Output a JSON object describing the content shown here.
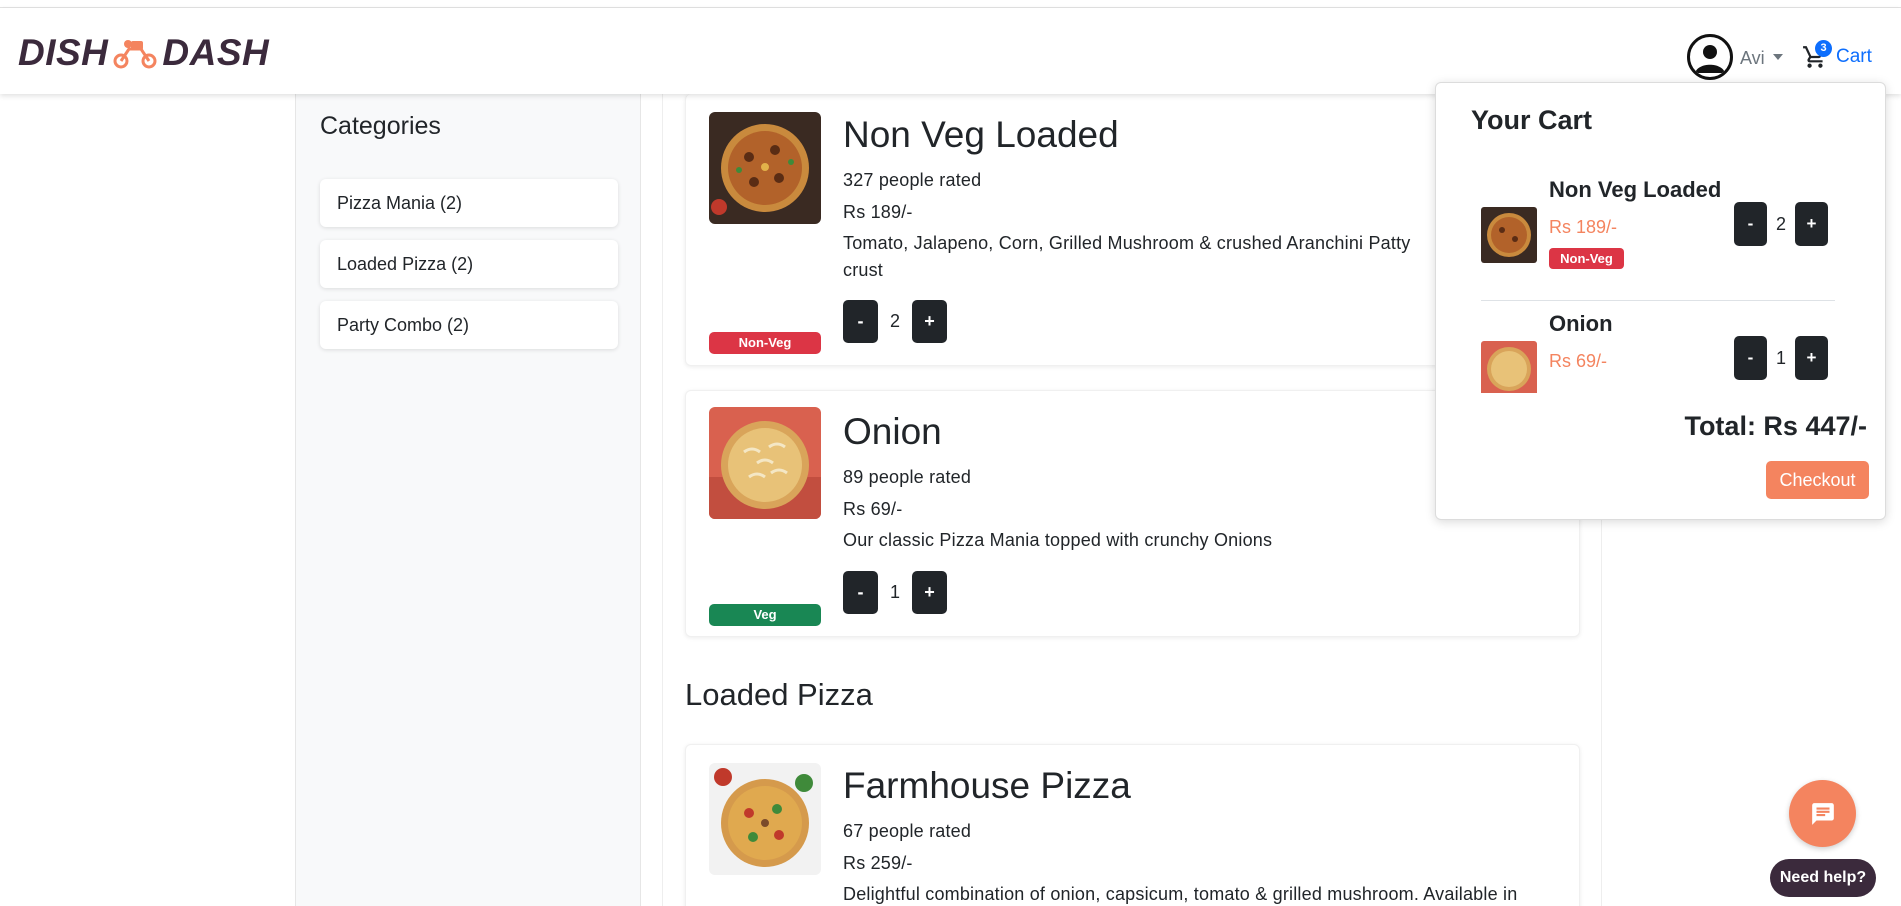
{
  "brand": {
    "logo_left": "DISH",
    "logo_right": "DASH"
  },
  "navbar": {
    "user_name": "Avi",
    "cart_label": "Cart",
    "cart_count": "3"
  },
  "sidebar": {
    "title": "Categories",
    "items": [
      {
        "label": "Pizza Mania (2)"
      },
      {
        "label": "Loaded Pizza (2)"
      },
      {
        "label": "Party Combo (2)"
      }
    ]
  },
  "menu": {
    "items": [
      {
        "name": "Non Veg Loaded",
        "ratings": "327 people rated",
        "price": "Rs 189/-",
        "description": "Tomato, Jalapeno, Corn, Grilled Mushroom & crushed Aranchini Patty",
        "description_end": "crust",
        "type": "Non-Veg",
        "qty": "2",
        "minus": "-",
        "plus": "+"
      },
      {
        "name": "Onion",
        "ratings": "89 people rated",
        "price": "Rs 69/-",
        "description": "Our classic Pizza Mania topped with crunchy Onions",
        "type": "Veg",
        "qty": "1",
        "minus": "-",
        "plus": "+"
      }
    ],
    "section_title": "Loaded Pizza",
    "next_item": {
      "name": "Farmhouse Pizza",
      "ratings": "67 people rated",
      "price": "Rs 259/-",
      "description": "Delightful combination of onion, capsicum, tomato & grilled mushroom. Available in"
    }
  },
  "cart_popup": {
    "title": "Your Cart",
    "items": [
      {
        "name": "Non Veg Loaded",
        "price": "Rs 189/-",
        "badge": "Non-Veg",
        "qty": "2",
        "minus": "-",
        "plus": "+"
      },
      {
        "name": "Onion",
        "price": "Rs 69/-",
        "qty": "1",
        "minus": "-",
        "plus": "+"
      }
    ],
    "total": "Total: Rs 447/-",
    "checkout": "Checkout"
  },
  "help": {
    "label": "Need help?"
  },
  "colors": {
    "accent": "#f4845f",
    "brand_dark": "#3b2a3c",
    "link": "#0d6efd",
    "nonveg": "#dc3545",
    "veg": "#198754"
  }
}
